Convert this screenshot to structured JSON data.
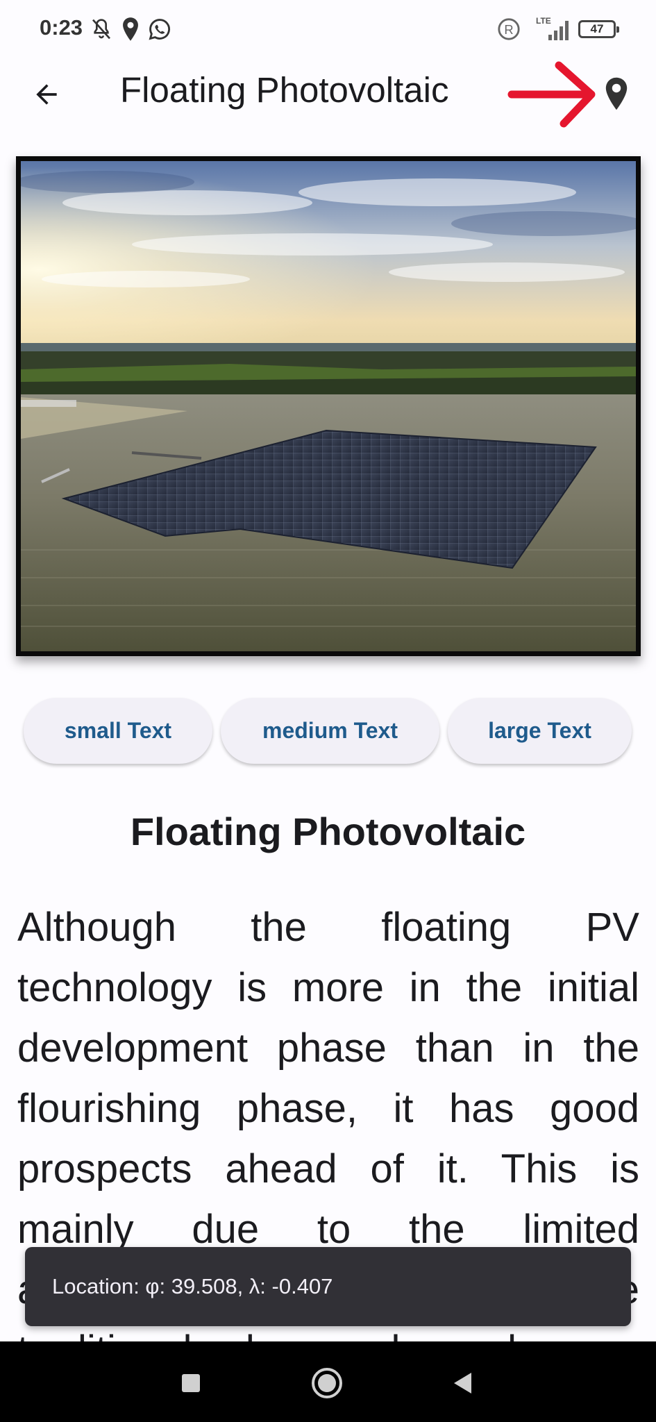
{
  "status_bar": {
    "time": "0:23",
    "network": "LTE",
    "battery": "47",
    "icons": [
      "bell-off-icon",
      "location-pin-icon",
      "whatsapp-icon",
      "registered-icon",
      "signal-icon",
      "battery-icon"
    ]
  },
  "app_bar": {
    "title": "Floating Photovoltaic",
    "back_icon": "arrow-back-icon",
    "location_icon": "location-pin-icon",
    "annotation": "red-arrow-icon"
  },
  "hero_image": {
    "subject": "floating solar panel array on a lake"
  },
  "text_size_buttons": {
    "small": "small Text",
    "medium": "medium Text",
    "large": "large Text"
  },
  "article": {
    "heading": "Floating Photovoltaic",
    "body": "Although the floating PV technology is more in the initial development phase than in the flourishing phase, it has good prospects ahead of it. This is mainly due to the limited availability of land on which the traditional solar panels can be"
  },
  "snackbar": {
    "text": "Location: φ: 39.508, λ: -0.407"
  },
  "nav_bar": {
    "icons": [
      "recents-square-icon",
      "home-circle-icon",
      "back-triangle-icon"
    ]
  },
  "colors": {
    "accent": "#1f5b8c",
    "annotation_red": "#e5162e",
    "snackbar_bg": "#313036"
  }
}
